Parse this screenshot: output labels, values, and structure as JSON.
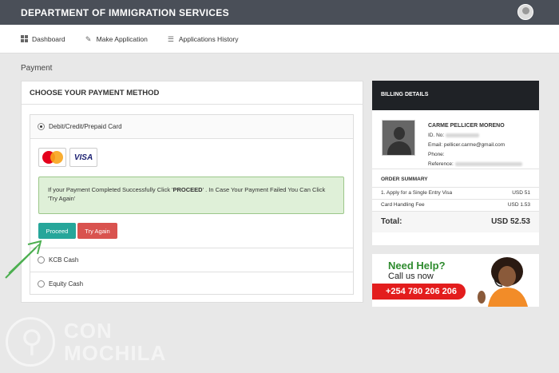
{
  "app": {
    "title": "DEPARTMENT OF IMMIGRATION SERVICES"
  },
  "nav": {
    "items": [
      {
        "label": "Dashboard",
        "icon": "dashboard-icon"
      },
      {
        "label": "Make Application",
        "icon": "pencil-icon"
      },
      {
        "label": "Applications History",
        "icon": "list-icon"
      }
    ]
  },
  "page": {
    "title": "Payment"
  },
  "payment": {
    "header": "CHOOSE YOUR PAYMENT METHOD",
    "methods": [
      {
        "label": "Debit/Credit/Prepaid Card",
        "selected": true
      },
      {
        "label": "KCB Cash",
        "selected": false
      },
      {
        "label": "Equity Cash",
        "selected": false
      }
    ],
    "cards": [
      "MasterCard",
      "VISA"
    ],
    "alert_pre": "If your Payment Completed Successfully Click '",
    "alert_bold": "PROCEED",
    "alert_post": "' . In Case Your Payment Failed You Can Click 'Try Again'",
    "proceed_label": "Proceed",
    "retry_label": "Try Again"
  },
  "billing": {
    "header": "BILLING DETAILS",
    "name": "CARME PELLICER MORENO",
    "id_label": "ID. No:",
    "email_label": "Email:",
    "email": "pellicer.carme@gmail.com",
    "phone_label": "Phone:",
    "reference_label": "Reference:",
    "summary_header": "ORDER SUMMARY",
    "items": [
      {
        "label": "1. Apply for a Single Entry Visa",
        "amount": "USD 51"
      },
      {
        "label": "Card Handling Fee",
        "amount": "USD 1.53"
      }
    ],
    "total_label": "Total:",
    "total_amount": "USD 52.53"
  },
  "help": {
    "title": "Need Help?",
    "subtitle": "Call us now",
    "phone": "+254 780 206 206"
  },
  "watermark": {
    "line1": "CON",
    "line2": "MOCHILA"
  },
  "colors": {
    "topbar": "#4a4f58",
    "proceed": "#26a69a",
    "retry": "#d9534f",
    "alert_bg": "#dff0d8",
    "billing_header": "#1f2226",
    "help_red": "#e31d1d",
    "help_green": "#2e8b2e"
  }
}
